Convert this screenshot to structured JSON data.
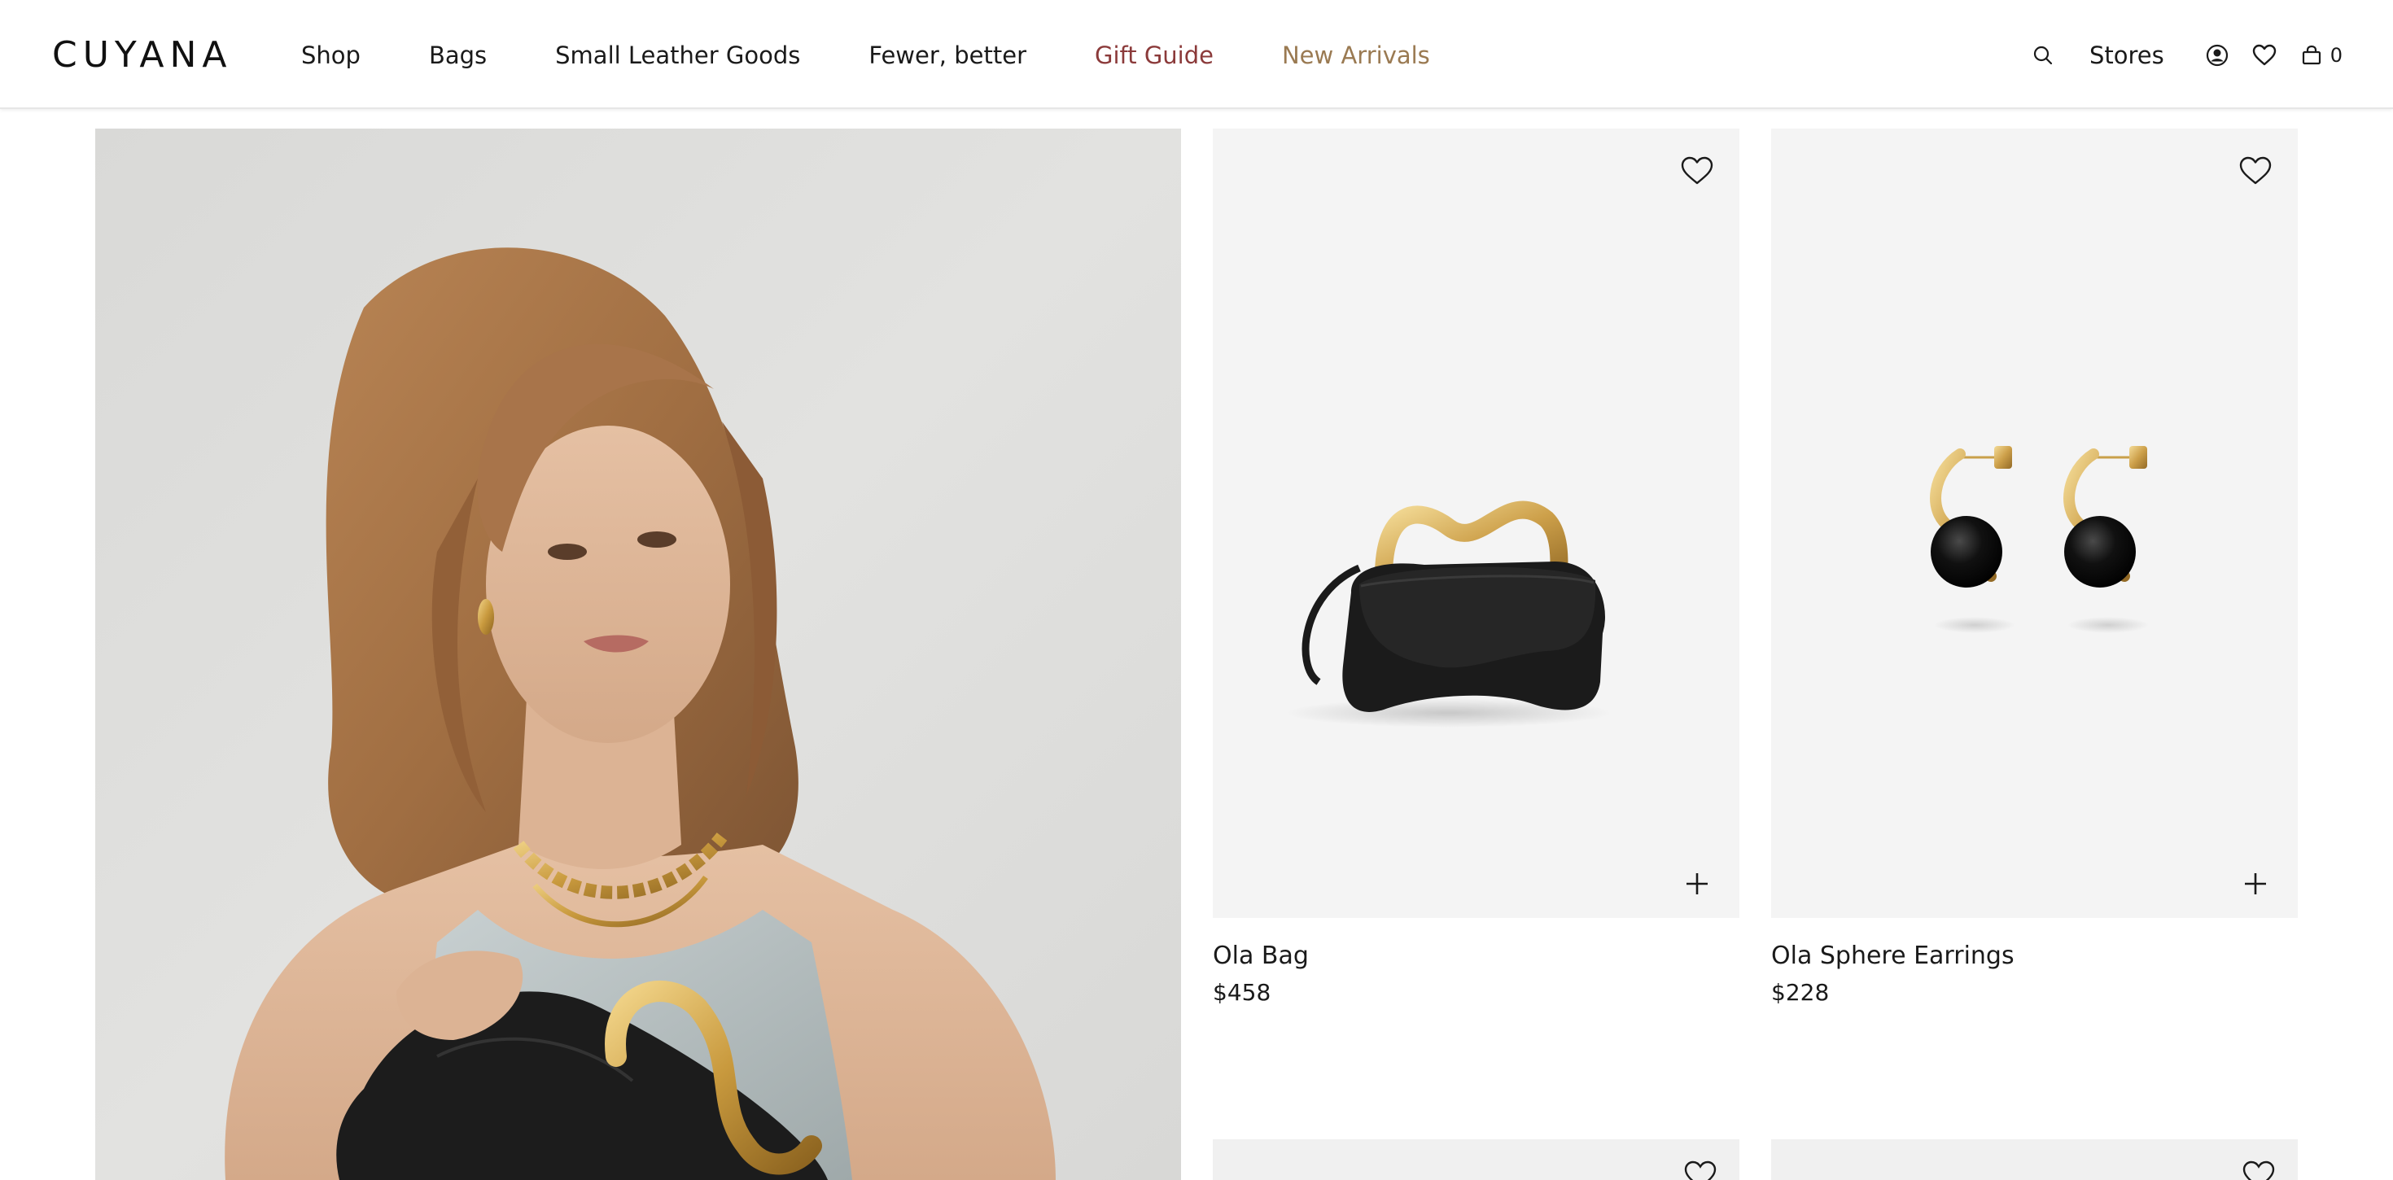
{
  "brand": {
    "logo_text": "CUYANA"
  },
  "nav": {
    "items": [
      {
        "label": "Shop"
      },
      {
        "label": "Bags"
      },
      {
        "label": "Small Leather Goods"
      },
      {
        "label": "Fewer, better"
      },
      {
        "label": "Gift Guide"
      },
      {
        "label": "New Arrivals"
      }
    ]
  },
  "tools": {
    "stores_label": "Stores",
    "cart_count": "0",
    "icons": [
      "search-icon",
      "account-icon",
      "wishlist-icon",
      "bag-icon"
    ]
  },
  "products": [
    {
      "name": "Ola Bag",
      "price": "$458"
    },
    {
      "name": "Ola Sphere Earrings",
      "price": "$228"
    }
  ],
  "colors": {
    "gift_guide": "#8b3a3a",
    "new_arrivals": "#9a7a52",
    "card_bg": "#f4f4f4"
  }
}
